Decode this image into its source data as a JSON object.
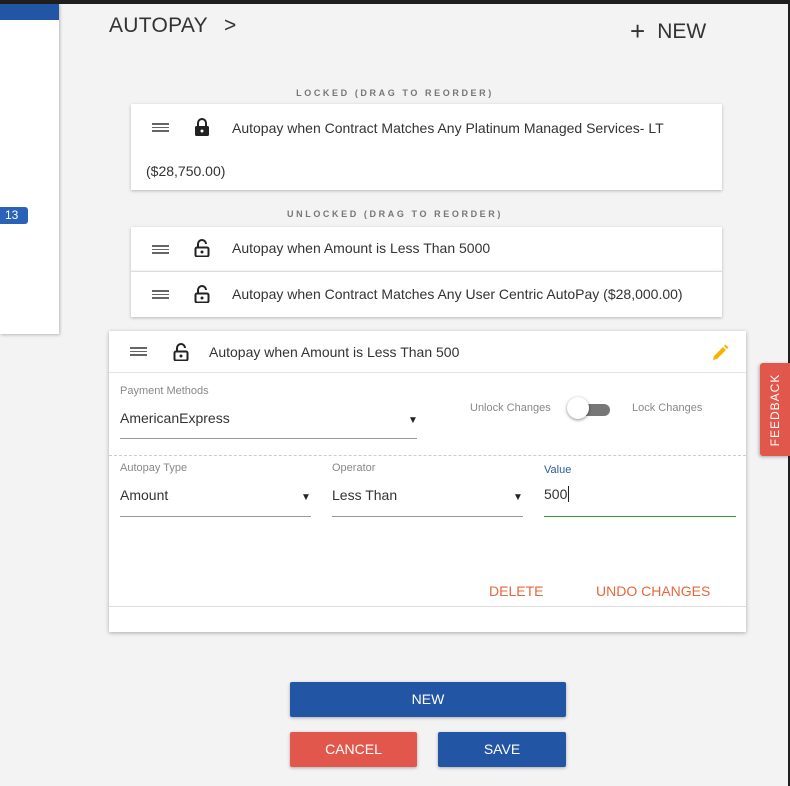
{
  "header": {
    "title": "AUTOPAY",
    "chevron": ">",
    "new_plus": "+",
    "new_label": "NEW"
  },
  "sidebar": {
    "badge": "13"
  },
  "locked_section": {
    "label": "LOCKED (DRAG TO REORDER)",
    "rules": [
      {
        "text_line1": "Autopay when Contract Matches Any Platinum Managed Services- LT",
        "text_line2": "($28,750.00)",
        "locked": true
      }
    ]
  },
  "unlocked_section": {
    "label": "UNLOCKED (DRAG TO REORDER)",
    "rules": [
      {
        "text": "Autopay when Amount is Less Than 5000",
        "locked": false
      },
      {
        "text": "Autopay when Contract Matches Any User Centric AutoPay ($28,000.00)",
        "locked": false
      }
    ]
  },
  "edit_panel": {
    "title": "Autopay when Amount is Less Than 500",
    "payment_methods": {
      "label": "Payment Methods",
      "value": "AmericanExpress"
    },
    "toggle": {
      "left_label": "Unlock Changes",
      "right_label": "Lock Changes",
      "state": "unlocked"
    },
    "autopay_type": {
      "label": "Autopay Type",
      "value": "Amount"
    },
    "operator": {
      "label": "Operator",
      "value": "Less Than"
    },
    "value_field": {
      "label": "Value",
      "value": "500"
    },
    "delete_label": "DELETE",
    "undo_label": "UNDO CHANGES"
  },
  "buttons": {
    "new": "NEW",
    "cancel": "CANCEL",
    "save": "SAVE"
  },
  "feedback_label": "FEEDBACK",
  "colors": {
    "primary": "#2255a4",
    "danger": "#e2574c",
    "accent_text": "#e8663c",
    "edit_icon": "#f4b400",
    "active_underline": "#3a9a3a"
  },
  "icons": {
    "drag": "drag-handle-icon",
    "lock_closed": "lock-closed-icon",
    "lock_open": "lock-open-icon",
    "edit": "pencil-icon",
    "dropdown": "caret-down-icon"
  }
}
